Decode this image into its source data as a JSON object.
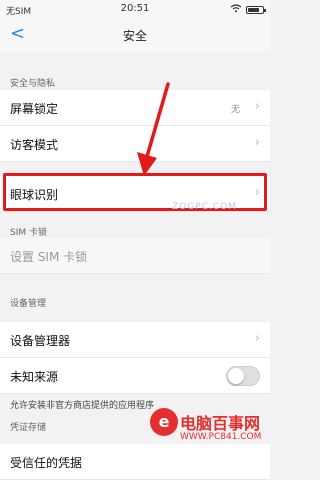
{
  "status_bar": {
    "carrier": "无SIM",
    "time": "20:51",
    "battery_fill": 0.8
  },
  "nav": {
    "back_label": "<",
    "title": "安全"
  },
  "sections": {
    "privacy": "安全与隐私",
    "sim": "SIM 卡锁",
    "device": "设备管理",
    "credentials": "凭证存储"
  },
  "rows": {
    "screen_lock": {
      "label": "屏幕锁定",
      "value": "无"
    },
    "guest_mode": {
      "label": "访客模式"
    },
    "eye_recognition": {
      "label": "眼球识别"
    },
    "sim_lock": {
      "label": "设置 SIM 卡锁"
    },
    "device_manager": {
      "label": "设备管理器"
    },
    "unknown_sources": {
      "label": "未知来源"
    },
    "trusted_credentials": {
      "label": "受信任的凭据"
    }
  },
  "unknown_sources_note": "允许安装非官方商店提供的应用程序",
  "watermark": {
    "ghost_text": "ZOGPC.COM",
    "brand_name": "电脑百事网",
    "brand_url": "WWW.PC841.COM"
  },
  "colors": {
    "accent": "#2a8cd8",
    "highlight": "#e21a1a",
    "brand": "#e52f2f"
  }
}
